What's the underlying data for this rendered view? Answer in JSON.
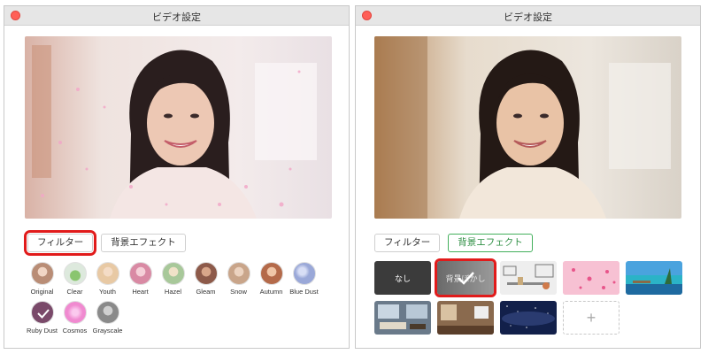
{
  "left_window": {
    "title": "ビデオ設定",
    "tabs": {
      "filter": "フィルター",
      "background": "背景エフェクト"
    },
    "filters": [
      {
        "label": "Original",
        "color": "#b98d76"
      },
      {
        "label": "Clear",
        "color": "#5a9a48"
      },
      {
        "label": "Youth",
        "color": "#e8c9a4"
      },
      {
        "label": "Heart",
        "color": "#d98aa4"
      },
      {
        "label": "Hazel",
        "color": "#a8c89a"
      },
      {
        "label": "Gleam",
        "color": "#8d5a4a"
      },
      {
        "label": "Snow",
        "color": "#c9a58a"
      },
      {
        "label": "Autumn",
        "color": "#b46a4a"
      },
      {
        "label": "Blue Dust",
        "color": "#9aa8d8"
      },
      {
        "label": "Ruby Dust",
        "color": "#7a4a6a",
        "selected": true
      },
      {
        "label": "Cosmos",
        "color": "#f08ad0"
      },
      {
        "label": "Grayscale",
        "color": "#8a8a8a"
      }
    ]
  },
  "right_window": {
    "title": "ビデオ設定",
    "tabs": {
      "filter": "フィルター",
      "background": "背景エフェクト"
    },
    "backgrounds": [
      {
        "label": "なし",
        "kind": "none"
      },
      {
        "label": "背景ぼかし",
        "kind": "blur",
        "selected": true
      },
      {
        "label": "",
        "kind": "office-sketch"
      },
      {
        "label": "",
        "kind": "pink-hearts"
      },
      {
        "label": "",
        "kind": "beach"
      },
      {
        "label": "",
        "kind": "living-room"
      },
      {
        "label": "",
        "kind": "cafe"
      },
      {
        "label": "",
        "kind": "night-sky"
      },
      {
        "label": "+",
        "kind": "add"
      }
    ]
  },
  "icons": {
    "checkmark": "check-icon",
    "plus": "plus-icon"
  }
}
